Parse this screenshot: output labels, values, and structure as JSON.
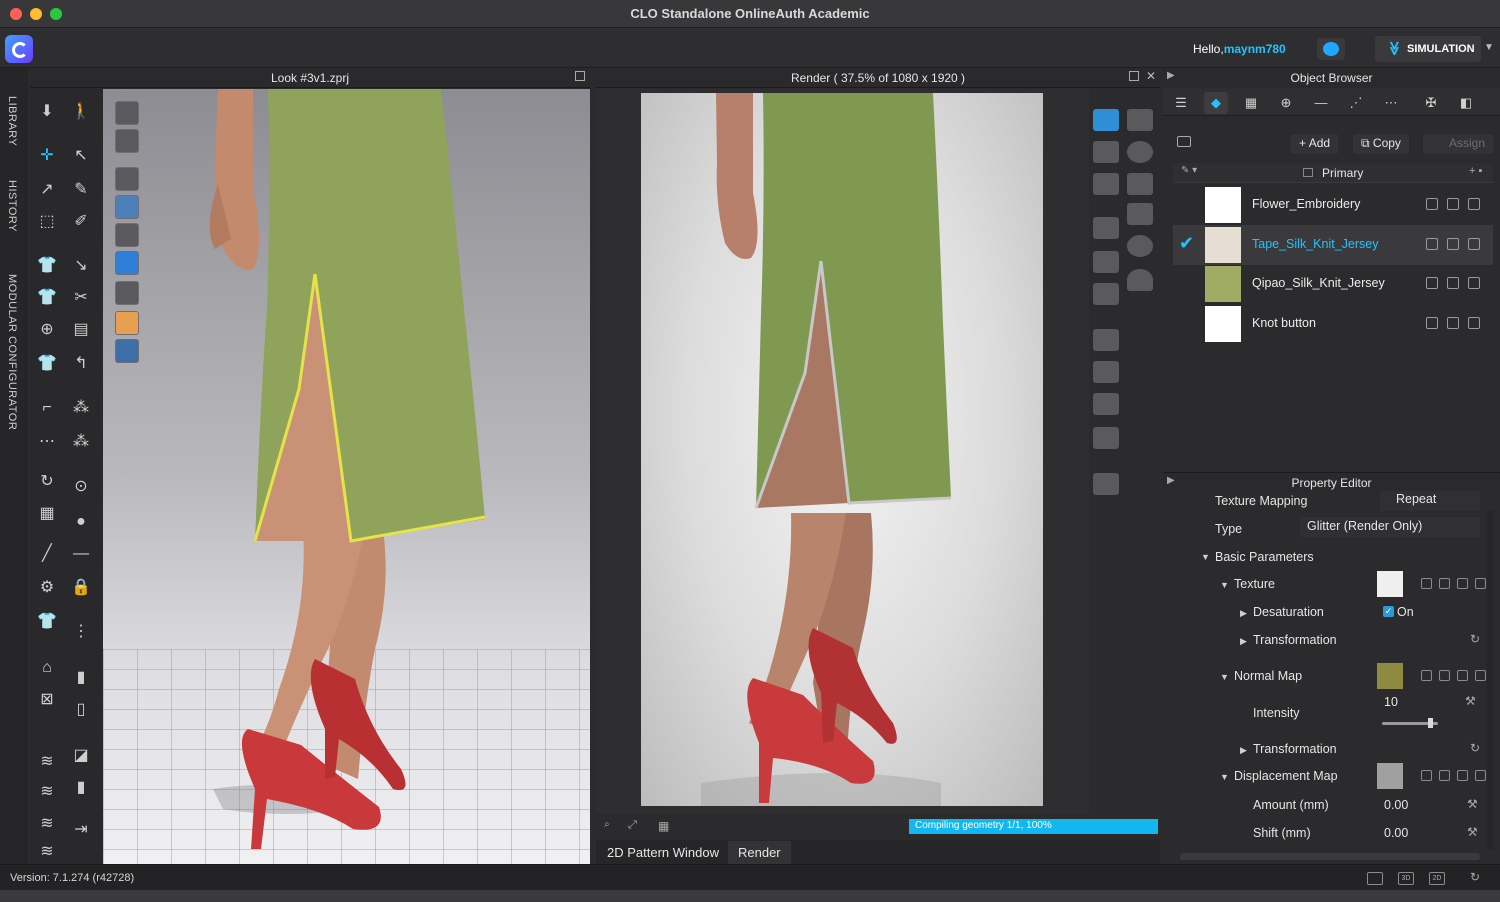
{
  "window": {
    "title": "CLO Standalone OnlineAuth Academic"
  },
  "header": {
    "greeting": "Hello,",
    "username": "maynm780",
    "simulation_label": "SIMULATION"
  },
  "sidebar_tabs": [
    "LIBRARY",
    "HISTORY",
    "MODULAR CONFIGURATOR"
  ],
  "view3d": {
    "title": "Look #3v1.zprj"
  },
  "render": {
    "title": "Render ( 37.5% of 1080 x 1920 )",
    "progress_text": "Compiling geometry 1/1, 100%",
    "progress": 1.0
  },
  "bottom_tabs": {
    "pattern": "2D Pattern Window",
    "render": "Render"
  },
  "object_browser": {
    "title": "Object Browser",
    "add_label": "Add",
    "copy_label": "Copy",
    "assign_label": "Assign",
    "colorway": "Primary",
    "fabrics": [
      {
        "name": "Flower_Embroidery",
        "swatch": "#ffffff",
        "selected": false
      },
      {
        "name": "Tape_Silk_Knit_Jersey",
        "swatch": "#e6ddd3",
        "selected": true
      },
      {
        "name": "Qipao_Silk_Knit_Jersey",
        "swatch": "#a0ac64",
        "selected": false
      },
      {
        "name": "Knot button",
        "swatch": "#ffffff",
        "selected": false
      }
    ]
  },
  "property_editor": {
    "title": "Property Editor",
    "texture_mapping_label": "Texture Mapping",
    "texture_mapping_value": "Repeat",
    "type_label": "Type",
    "type_value": "Glitter (Render Only)",
    "basic_parameters": "Basic Parameters",
    "texture": "Texture",
    "desaturation": "Desaturation",
    "desaturation_value": "On",
    "transformation": "Transformation",
    "normal_map": "Normal Map",
    "intensity_label": "Intensity",
    "intensity_value": "10",
    "intensity_fraction": 0.9,
    "transformation2": "Transformation",
    "displacement_map": "Displacement Map",
    "amount_label": "Amount (mm)",
    "amount_value": "0.00",
    "shift_label": "Shift (mm)",
    "shift_value": "0.00"
  },
  "status": {
    "version": "Version: 7.1.274 (r42728)"
  },
  "colors": {
    "accent": "#23c3ff",
    "progress": "#11b7ee",
    "dress": "#8fa35a",
    "shoe": "#c9383a",
    "skin": "#c78d70"
  }
}
